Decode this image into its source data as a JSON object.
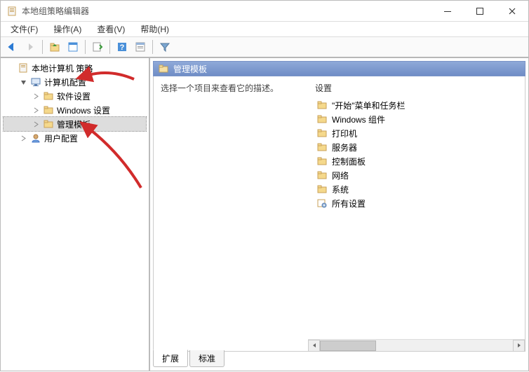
{
  "window": {
    "title": "本地组策略编辑器"
  },
  "menu": {
    "file": "文件(F)",
    "action": "操作(A)",
    "view": "查看(V)",
    "help": "帮助(H)"
  },
  "toolbar": {
    "back": "后退",
    "forward": "前进",
    "up": "上一级",
    "list": "列表",
    "detail": "详情",
    "help": "帮助",
    "props": "属性",
    "filter": "筛选"
  },
  "tree": {
    "root": "本地计算机 策略",
    "computer_config": "计算机配置",
    "software_settings": "软件设置",
    "windows_settings": "Windows 设置",
    "admin_templates": "管理模板",
    "user_config": "用户配置"
  },
  "content": {
    "title": "管理模板",
    "desc_prompt": "选择一个项目来查看它的描述。",
    "column_header": "设置",
    "items": [
      "\"开始\"菜单和任务栏",
      "Windows 组件",
      "打印机",
      "服务器",
      "控制面板",
      "网络",
      "系统",
      "所有设置"
    ]
  },
  "tabs": {
    "extended": "扩展",
    "standard": "标准"
  }
}
